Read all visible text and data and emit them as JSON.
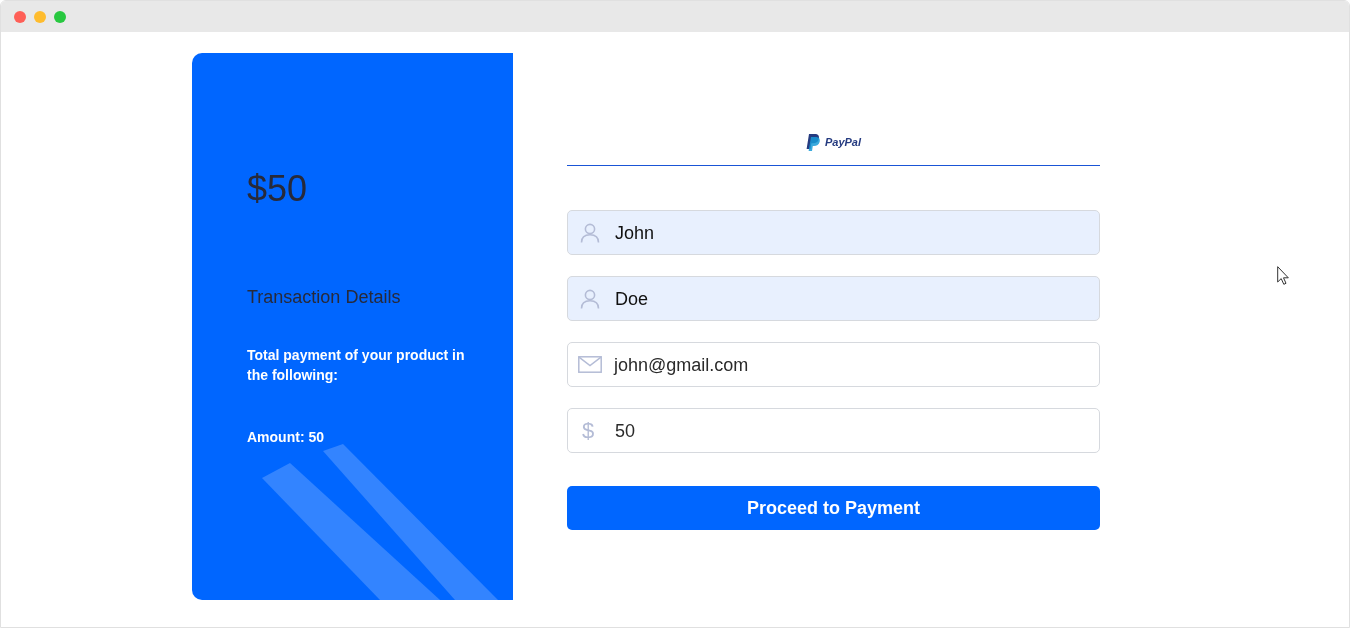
{
  "window_buttons": [
    {
      "color": "#fe5f57"
    },
    {
      "color": "#febc2e"
    },
    {
      "color": "#28c840"
    }
  ],
  "summary": {
    "amount_heading": "$50",
    "title": "Transaction Details",
    "description": "Total payment of your product in the following:",
    "amount_line": "Amount: 50"
  },
  "payment_tabs": [
    {
      "label": "PayPal",
      "selected": true
    }
  ],
  "form": {
    "fields": [
      {
        "kind": "name",
        "value": "John",
        "autofilled": true
      },
      {
        "kind": "name",
        "value": "Doe",
        "autofilled": true
      },
      {
        "kind": "email",
        "value": "john@gmail.com",
        "autofilled": false
      },
      {
        "kind": "amount",
        "prefix": "$",
        "value": "50",
        "autofilled": false
      }
    ],
    "submit": "Proceed to Payment"
  }
}
